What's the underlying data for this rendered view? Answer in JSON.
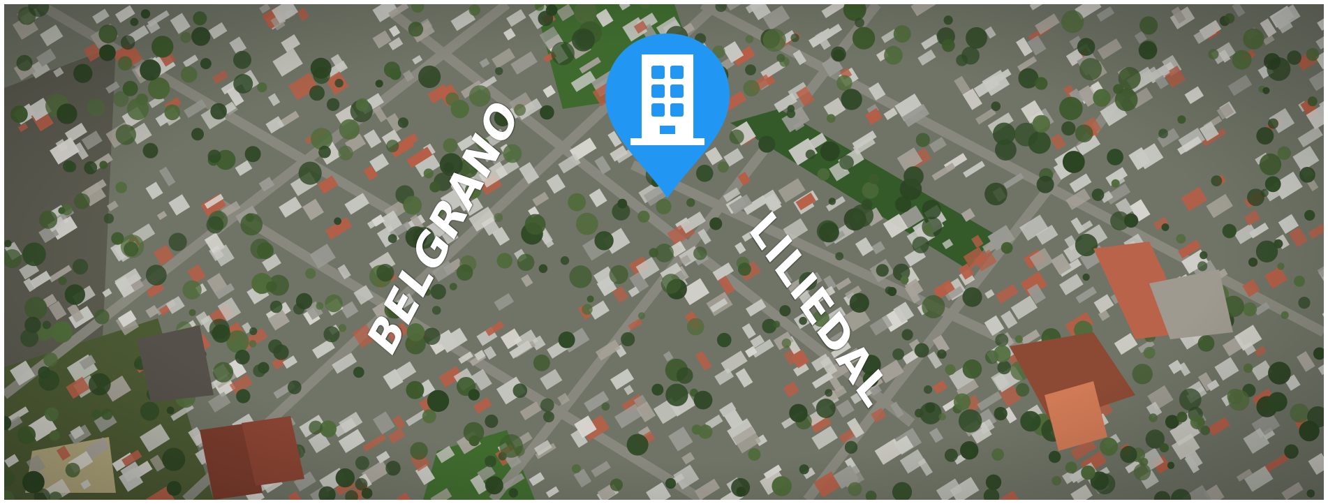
{
  "map": {
    "view": "satellite aerial",
    "colors": {
      "vegetation": "#2f4a26",
      "vegetation_light": "#4f6b3a",
      "roof_light": "#c9c9c4",
      "roof_gray": "#9a9a94",
      "roof_terracotta": "#b75e46",
      "road": "#7d7d75",
      "field": "#5f6a3e"
    }
  },
  "labels": {
    "belgrano": "BELGRANO",
    "liliedal": "LILIEDAL"
  },
  "marker": {
    "icon": "building-icon",
    "color": "#2196f3",
    "icon_color": "#ffffff"
  }
}
